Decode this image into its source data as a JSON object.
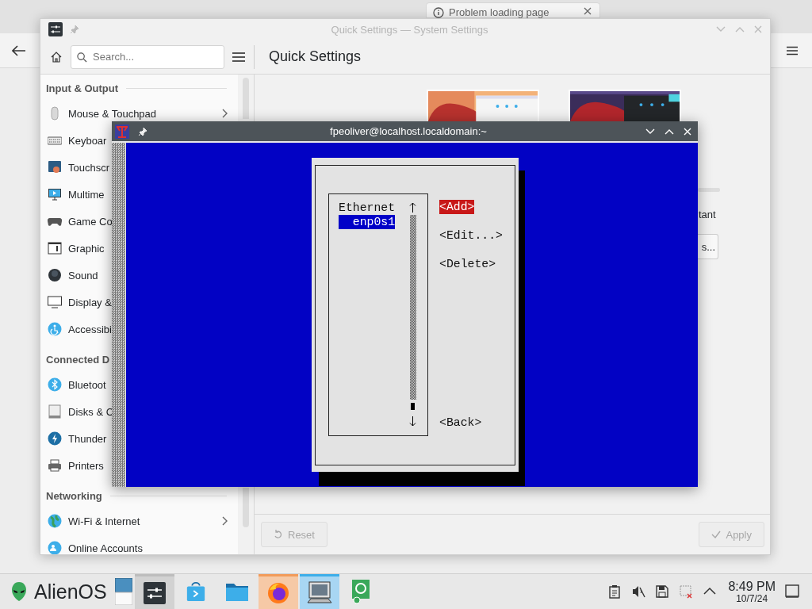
{
  "browser": {
    "active_tab": {
      "label": "Problem loading page"
    }
  },
  "settings_window": {
    "title": "Quick Settings — System Settings",
    "search": {
      "placeholder": "Search..."
    },
    "page_title": "Quick Settings",
    "sidebar": [
      {
        "heading": "Input & Output",
        "items": [
          {
            "label": "Mouse & Touchpad",
            "kind": "mouse",
            "submenu": true
          },
          {
            "label": "Keyboar",
            "kind": "keyboard",
            "submenu": false
          },
          {
            "label": "Touchscr",
            "kind": "touchscreen",
            "submenu": false
          },
          {
            "label": "Multime",
            "kind": "multimedia",
            "submenu": false
          },
          {
            "label": "Game Co",
            "kind": "gamepad",
            "submenu": false
          },
          {
            "label": "Graphic",
            "kind": "tablet",
            "submenu": false
          },
          {
            "label": "Sound",
            "kind": "sound",
            "submenu": false
          },
          {
            "label": "Display &",
            "kind": "display",
            "submenu": false
          },
          {
            "label": "Accessibi",
            "kind": "accessibility",
            "submenu": false
          }
        ]
      },
      {
        "heading": "Connected D",
        "items": [
          {
            "label": "Bluetoot",
            "kind": "bluetooth",
            "submenu": false
          },
          {
            "label": "Disks & C",
            "kind": "disks",
            "submenu": false
          },
          {
            "label": "Thunder",
            "kind": "thunderbolt",
            "submenu": false
          },
          {
            "label": "Printers",
            "kind": "printer",
            "submenu": false
          }
        ]
      },
      {
        "heading": "Networking",
        "items": [
          {
            "label": "Wi-Fi & Internet",
            "kind": "globe",
            "submenu": true
          },
          {
            "label": "Online Accounts",
            "kind": "accounts",
            "submenu": false
          }
        ]
      }
    ],
    "fragments": {
      "label": "tant",
      "button": "s..."
    },
    "footer": [
      {
        "label": "Reset",
        "kind": "reset",
        "disabled": true
      },
      {
        "label": "Apply",
        "kind": "apply",
        "disabled": true
      }
    ]
  },
  "terminal": {
    "title": "fpeoliver@localhost.localdomain:~",
    "dialog": {
      "list": {
        "heading": "Ethernet",
        "items": [
          {
            "label": "enp0s1",
            "selected": true
          }
        ]
      },
      "actions": [
        {
          "label": "<Add>",
          "selected": true
        },
        {
          "label": "<Edit...>",
          "selected": false
        },
        {
          "label": "<Delete>",
          "selected": false
        }
      ],
      "back": {
        "label": "<Back>",
        "selected": false
      }
    }
  },
  "taskbar": {
    "launcher": "AlienOS",
    "tasks": [
      {
        "kind": "settings",
        "open": true,
        "focused": false,
        "attention": false
      },
      {
        "kind": "store",
        "open": false,
        "focused": false,
        "attention": false
      },
      {
        "kind": "files",
        "open": false,
        "focused": false,
        "attention": false
      },
      {
        "kind": "browser",
        "open": true,
        "focused": false,
        "attention": true
      },
      {
        "kind": "terminal",
        "open": true,
        "focused": true,
        "attention": false
      },
      {
        "kind": "app",
        "open": false,
        "focused": false,
        "attention": false
      }
    ],
    "tray": [
      {
        "kind": "clipboard"
      },
      {
        "kind": "volume-muted"
      },
      {
        "kind": "save"
      },
      {
        "kind": "network-off"
      },
      {
        "kind": "expand"
      }
    ],
    "clock": {
      "time": "8:49 PM",
      "date": "10/7/24"
    }
  }
}
